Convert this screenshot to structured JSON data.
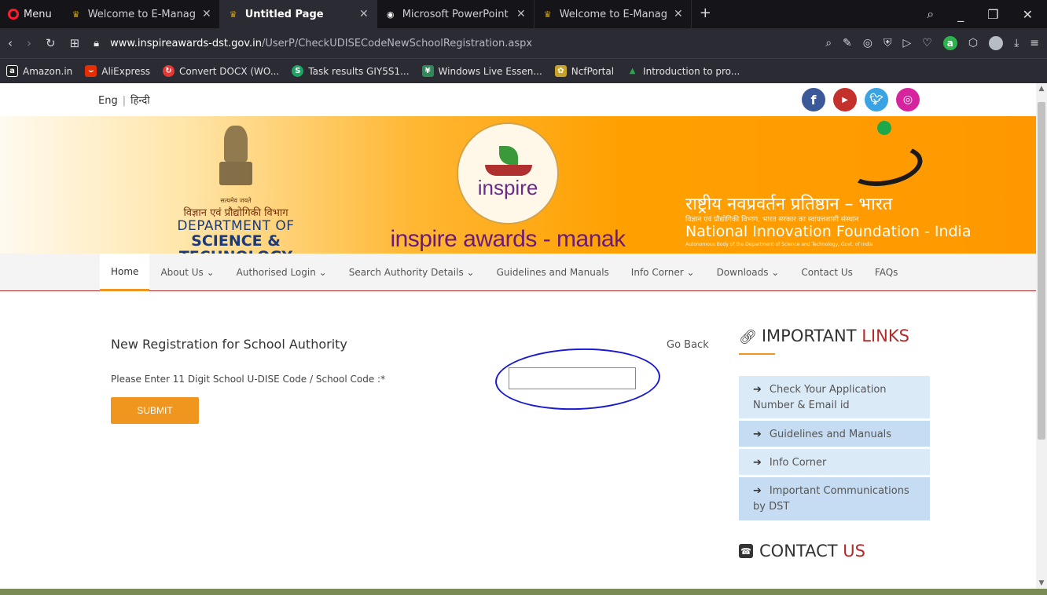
{
  "browser": {
    "menu_label": "Menu",
    "tabs": [
      {
        "title": "Welcome to E-Managemen",
        "active": false
      },
      {
        "title": "Untitled Page",
        "active": true
      },
      {
        "title": "Microsoft PowerPoint - E-M",
        "active": false
      },
      {
        "title": "Welcome to E-Managemen",
        "active": false
      }
    ],
    "url_host": "www.inspireawards-dst.gov.in",
    "url_path": "/UserP/CheckUDISECodeNewSchoolRegistration.aspx",
    "bookmarks": [
      {
        "label": "Amazon.in",
        "icon": "amazon-icon",
        "color": "#222222",
        "glyph": "a"
      },
      {
        "label": "AliExpress",
        "icon": "aliexpress-icon",
        "color": "#e62e04",
        "glyph": "A"
      },
      {
        "label": "Convert DOCX (WO...",
        "icon": "convert-icon",
        "color": "#e53935",
        "glyph": "C"
      },
      {
        "label": "Task results GIY5S1...",
        "icon": "task-icon",
        "color": "#1ea462",
        "glyph": "S"
      },
      {
        "label": "Windows Live Essen...",
        "icon": "windows-live-icon",
        "color": "#2e8b57",
        "glyph": "W"
      },
      {
        "label": "NcfPortal",
        "icon": "ncf-icon",
        "color": "#c9a227",
        "glyph": "N"
      },
      {
        "label": "Introduction to pro...",
        "icon": "intro-icon",
        "color": "#2a8a3a",
        "glyph": "I"
      }
    ]
  },
  "page": {
    "lang_en": "Eng",
    "lang_sep": "|",
    "lang_hi": "हिन्दी",
    "dst": {
      "motto": "सत्यमेव जयते",
      "hindi": "विज्ञान एवं प्रौद्योगिकी विभाग",
      "line1": "DEPARTMENT OF",
      "line2": "SCIENCE & TECHNOLOGY"
    },
    "inspire": {
      "seal_word": "inspire",
      "title": "inspire awards - manak"
    },
    "nif": {
      "hindi": "राष्ट्रीय नवप्रवर्तन प्रतिष्ठान – भारत",
      "hindi_sub": "विज्ञान एवं प्रौद्योगिकी विभाग, भारत सरकार का स्वायत्तशासी संस्थान",
      "english": "National Innovation Foundation - India",
      "english_sub": "Autonomous Body of the Department of Science and Technology, Govt. of India"
    },
    "nav": [
      {
        "label": "Home",
        "dropdown": false
      },
      {
        "label": "About Us",
        "dropdown": true
      },
      {
        "label": "Authorised Login",
        "dropdown": true
      },
      {
        "label": "Search Authority Details",
        "dropdown": true
      },
      {
        "label": "Guidelines and Manuals",
        "dropdown": false
      },
      {
        "label": "Info Corner",
        "dropdown": true
      },
      {
        "label": "Downloads",
        "dropdown": true
      },
      {
        "label": "Contact Us",
        "dropdown": false
      },
      {
        "label": "FAQs",
        "dropdown": false
      }
    ],
    "form": {
      "title": "New Registration for School Authority",
      "go_back": "Go Back",
      "code_label": "Please Enter 11 Digit School U-DISE Code / School Code :*",
      "code_value": "",
      "submit": "SUBMIT"
    },
    "important_links": {
      "title_a": "IMPORTANT",
      "title_b": "LINKS",
      "items": [
        "Check Your Application Number & Email id",
        "Guidelines and Manuals",
        "Info Corner",
        "Important Communications by DST"
      ]
    },
    "contact": {
      "title_a": "CONTACT",
      "title_b": "US"
    }
  },
  "colors": {
    "accent_orange": "#f0951d",
    "brand_red": "#b52a2a",
    "link_box": "#dbeaf7"
  }
}
